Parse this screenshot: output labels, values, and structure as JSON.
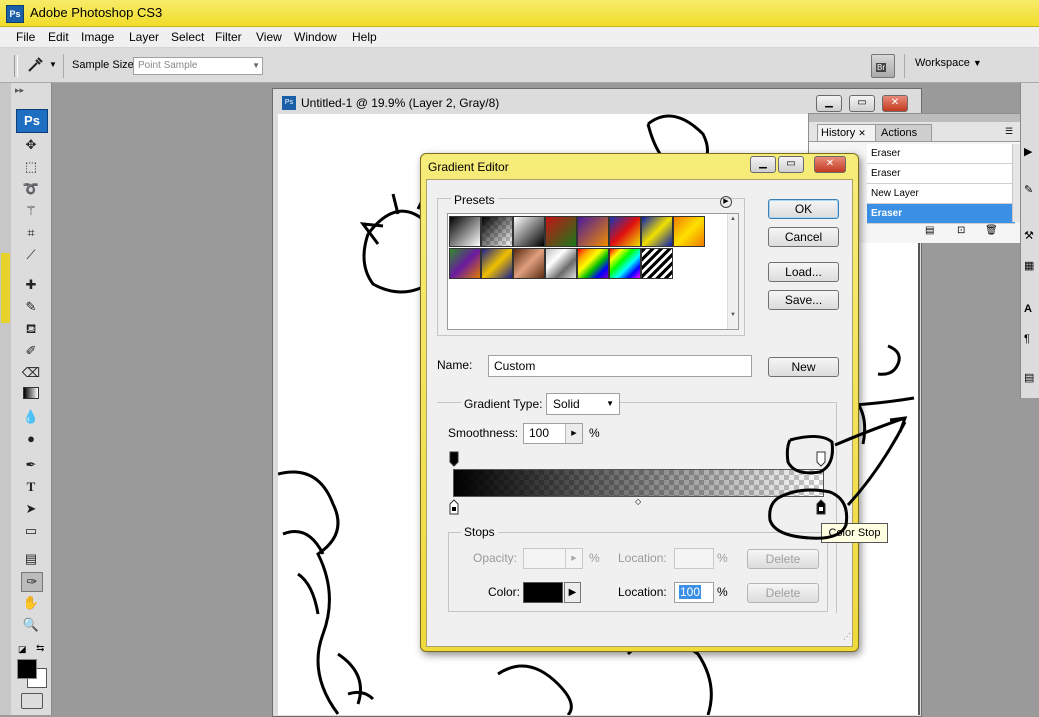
{
  "app": {
    "title": "Adobe Photoshop CS3",
    "icon_text": "Ps"
  },
  "menu": [
    "File",
    "Edit",
    "Image",
    "Layer",
    "Select",
    "Filter",
    "View",
    "Window",
    "Help"
  ],
  "options_bar": {
    "sample_size_label": "Sample Size:",
    "sample_size_value": "Point Sample",
    "workspace_label": "Workspace",
    "bridge_icon_text": "Br"
  },
  "toolbox": {
    "logo": "Ps"
  },
  "document": {
    "title": "Untitled-1 @ 19.9% (Layer 2, Gray/8)"
  },
  "history_panel": {
    "tabs": [
      "History",
      "Actions"
    ],
    "items": [
      "Eraser",
      "Eraser",
      "New Layer",
      "Eraser"
    ],
    "selected_index": 3
  },
  "gradient_editor": {
    "title": "Gradient Editor",
    "presets_label": "Presets",
    "buttons": {
      "ok": "OK",
      "cancel": "Cancel",
      "load": "Load...",
      "save": "Save...",
      "new": "New"
    },
    "name_label": "Name:",
    "name_value": "Custom",
    "gradient_type_label": "Gradient Type:",
    "gradient_type_value": "Solid",
    "smoothness_label": "Smoothness:",
    "smoothness_value": "100",
    "percent": "%",
    "stops": {
      "label": "Stops",
      "opacity_label": "Opacity:",
      "opacity_unit": "%",
      "opacity_location_label": "Location:",
      "opacity_location_unit": "%",
      "delete_label": "Delete",
      "color_label": "Color:",
      "color_value": "#000000",
      "color_location_label": "Location:",
      "color_location_value": "100",
      "color_location_unit": "%"
    },
    "tooltip": "Color Stop"
  },
  "colors": {
    "titlebar": "#f1dc2a",
    "selection": "#3b8fe5",
    "accent": "#1a5fa8"
  }
}
